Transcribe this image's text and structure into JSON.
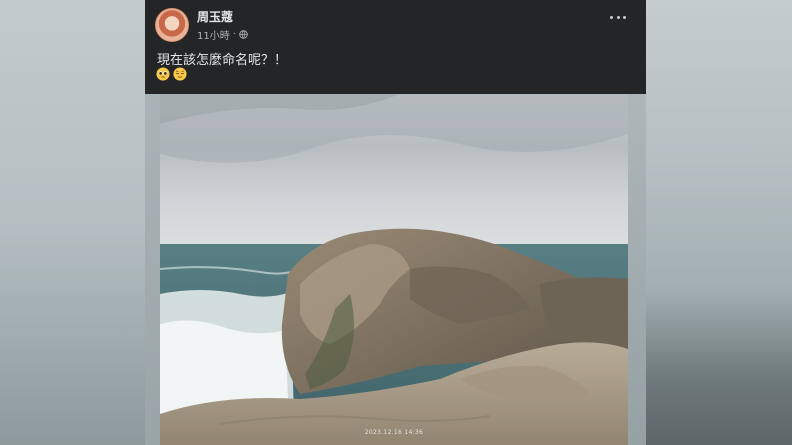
{
  "post": {
    "author": "周玉蔻",
    "time_label": "11小時",
    "separator": "·",
    "privacy_icon": "globe-icon",
    "text": "現在該怎麼命名呢？！",
    "emojis": [
      "pleading-face-emoji",
      "relieved-face-emoji"
    ],
    "more_icon": "more-options-icon"
  },
  "photo": {
    "alt_subject": "",
    "timestamp_text": "2023.12.16 14:36"
  },
  "colors": {
    "header_bg": "#242526",
    "text_primary": "#e4e6eb",
    "text_secondary": "#b0b3b8"
  }
}
